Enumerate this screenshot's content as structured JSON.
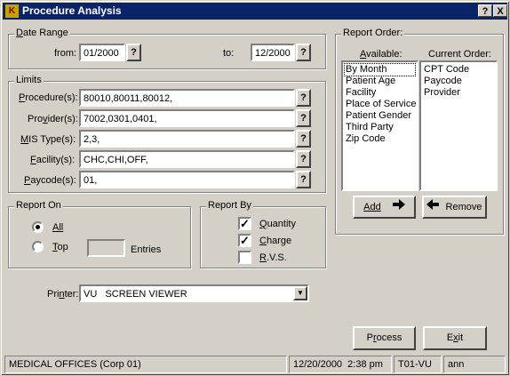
{
  "window": {
    "title": "Procedure Analysis",
    "help_label": "?",
    "close_label": "X"
  },
  "date_range": {
    "label": "Date Range",
    "from_label": "from:",
    "from_value": "01/2000",
    "to_label": "to:",
    "to_value": "12/2000",
    "lookup_label": "?"
  },
  "limits": {
    "label": "Limits",
    "rows": [
      {
        "label": "Procedure(s):",
        "value": "80010,80011,80012,"
      },
      {
        "label": "Provider(s):",
        "value": "7002,0301,0401,"
      },
      {
        "label": "MIS Type(s):",
        "value": "2,3,"
      },
      {
        "label": "Facility(s):",
        "value": "CHC,CHI,OFF,"
      },
      {
        "label": "Paycode(s):",
        "value": "01,"
      }
    ],
    "lookup_label": "?"
  },
  "report_on": {
    "label": "Report On",
    "all_label": "All",
    "top_label": "Top",
    "top_value": "",
    "entries_label": "Entries",
    "selected": "All"
  },
  "report_by": {
    "label": "Report By",
    "options": [
      {
        "label": "Quantity",
        "checked": true
      },
      {
        "label": "Charge",
        "checked": true
      },
      {
        "label": "R.V.S.",
        "checked": false
      }
    ]
  },
  "report_order": {
    "label": "Report Order:",
    "available_label": "Available:",
    "current_label": "Current Order:",
    "available": [
      "By Month",
      "Patient Age",
      "Facility",
      "Place of Service",
      "Patient Gender",
      "Third Party",
      "Zip Code"
    ],
    "current": [
      "CPT Code",
      "Paycode",
      "Provider"
    ],
    "add_label": "Add",
    "remove_label": "Remove"
  },
  "printer": {
    "label": "Printer:",
    "value": "VU   SCREEN VIEWER"
  },
  "actions": {
    "process_label": "Process",
    "exit_label": "Exit"
  },
  "status": {
    "office": "MEDICAL OFFICES (Corp 01)",
    "datetime": "12/20/2000  2:38 pm",
    "terminal": "T01-VU",
    "user": "ann"
  }
}
